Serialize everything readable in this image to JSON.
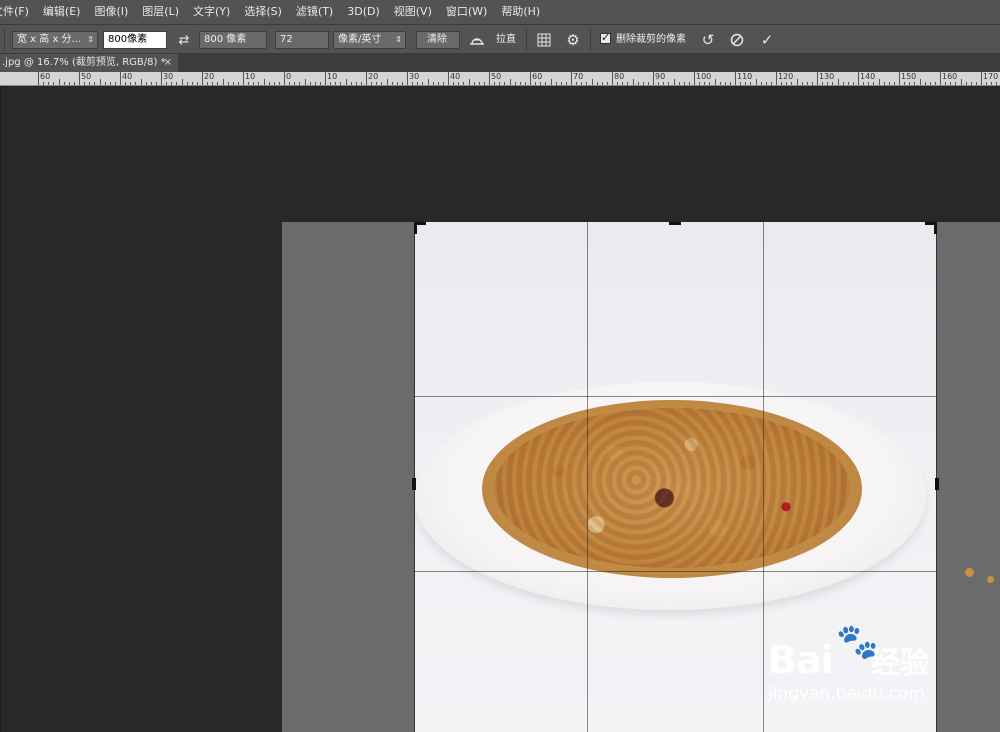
{
  "menu": {
    "items": [
      "文件(F)",
      "编辑(E)",
      "图像(I)",
      "图层(L)",
      "文字(Y)",
      "选择(S)",
      "滤镜(T)",
      "3D(D)",
      "视图(V)",
      "窗口(W)",
      "帮助(H)"
    ]
  },
  "options": {
    "ratio_select": "宽 x 高 x 分...",
    "width_value": "800像素",
    "height_value": "800 像素",
    "resolution_value": "72",
    "unit_select": "像素/英寸",
    "clear_button": "清除",
    "straighten_label": "拉直",
    "delete_cropped_label": "删除裁剪的像素",
    "delete_cropped_checked": true
  },
  "document": {
    "tab_title": ".jpg @ 16.7% (裁剪预览, RGB/8) *",
    "close_glyph": "×"
  },
  "ruler": {
    "labels": [
      "60",
      "50",
      "40",
      "30",
      "20",
      "10",
      "0",
      "10",
      "20",
      "30",
      "40",
      "50",
      "60",
      "70",
      "80",
      "90",
      "100",
      "110",
      "120",
      "130",
      "140",
      "150",
      "160",
      "170"
    ]
  },
  "watermark": {
    "brand": "Bai",
    "brand2": "经验",
    "url": "jingyan.baidu.com"
  },
  "icons": {
    "swap": "swap-icon",
    "straighten": "straighten-icon",
    "grid": "grid-overlay-icon",
    "gear": "gear-icon",
    "reset": "reset-icon",
    "cancel": "cancel-icon",
    "commit": "commit-icon"
  }
}
